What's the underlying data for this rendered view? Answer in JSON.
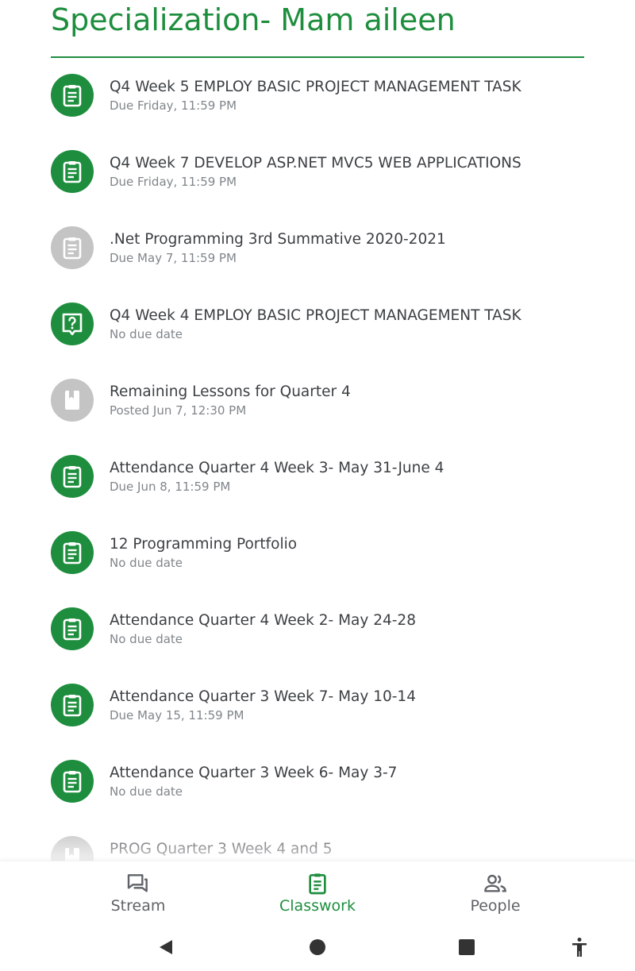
{
  "header": {
    "title": "Specialization- Mam aileen"
  },
  "items": [
    {
      "title": "Q4 Week 5 EMPLOY BASIC PROJECT MANAGEMENT TASK",
      "subtitle": "Due Friday, 11:59 PM",
      "icon": "assignment-icon",
      "state": "active"
    },
    {
      "title": "Q4 Week 7 DEVELOP ASP.NET MVC5 WEB APPLICATIONS",
      "subtitle": "Due Friday, 11:59 PM",
      "icon": "assignment-icon",
      "state": "active"
    },
    {
      "title": ".Net Programming 3rd Summative 2020-2021",
      "subtitle": "Due May 7, 11:59 PM",
      "icon": "assignment-icon",
      "state": "inactive"
    },
    {
      "title": "Q4 Week 4 EMPLOY BASIC PROJECT MANAGEMENT TASK",
      "subtitle": "No due date",
      "icon": "question-icon",
      "state": "active"
    },
    {
      "title": "Remaining Lessons for Quarter 4",
      "subtitle": "Posted Jun 7, 12:30 PM",
      "icon": "material-icon",
      "state": "inactive"
    },
    {
      "title": "Attendance Quarter 4 Week 3- May 31-June 4",
      "subtitle": "Due Jun 8, 11:59 PM",
      "icon": "assignment-icon",
      "state": "active"
    },
    {
      "title": "12 Programming Portfolio",
      "subtitle": "No due date",
      "icon": "assignment-icon",
      "state": "active"
    },
    {
      "title": "Attendance Quarter 4 Week 2- May 24-28",
      "subtitle": "No due date",
      "icon": "assignment-icon",
      "state": "active"
    },
    {
      "title": "Attendance Quarter 3 Week 7- May 10-14",
      "subtitle": "Due May 15, 11:59 PM",
      "icon": "assignment-icon",
      "state": "active"
    },
    {
      "title": "Attendance Quarter 3 Week 6- May 3-7",
      "subtitle": "No due date",
      "icon": "assignment-icon",
      "state": "active"
    },
    {
      "title": "PROG Quarter 3 Week 4 and 5",
      "subtitle": "",
      "icon": "material-icon",
      "state": "inactive"
    }
  ],
  "bottom_nav": {
    "stream": {
      "label": "Stream",
      "icon": "stream-icon"
    },
    "classwork": {
      "label": "Classwork",
      "icon": "classwork-icon",
      "active": true
    },
    "people": {
      "label": "People",
      "icon": "people-icon"
    }
  },
  "system_nav": {
    "back": "back-icon",
    "home": "home-icon",
    "recents": "recents-icon",
    "accessibility": "accessibility-icon"
  },
  "colors": {
    "accent": "#1e8e3e",
    "inactive_icon": "#c4c4c4",
    "primary_text": "#3c4043",
    "secondary_text": "#80868b"
  }
}
